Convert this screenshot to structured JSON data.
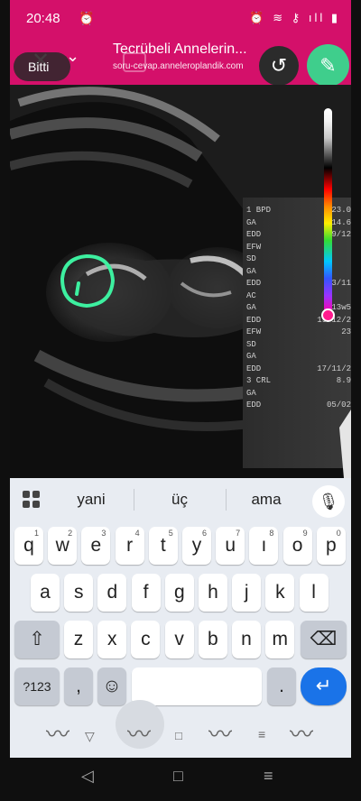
{
  "status": {
    "time": "20:48",
    "right_icons": "⏰ ≋ ⚷ ıll ▮"
  },
  "app_bar": {
    "title": "Tecrübeli Annelerin...",
    "url": "soru-cevap.anneleroplandik.com",
    "done_label": "Bitti"
  },
  "ultrasound": {
    "labels": [
      "1 BPD",
      "GA",
      "EDD",
      "EFW",
      "SD",
      "GA",
      "EDD",
      "AC",
      "GA",
      "EDD",
      "EFW",
      "SD",
      "GA",
      "EDD",
      "3 CRL",
      "GA",
      "EDD"
    ],
    "values": [
      "23.0",
      "14.6",
      "19/12",
      "",
      "",
      "",
      "13/11",
      "",
      "13w5",
      "19/12/2",
      "23",
      "",
      "",
      "17/11/2",
      "8.9",
      "",
      "05/02"
    ]
  },
  "keyboard": {
    "suggestions": [
      "yani",
      "üç",
      "ama"
    ],
    "row1": [
      {
        "k": "q",
        "h": "1"
      },
      {
        "k": "w",
        "h": "2"
      },
      {
        "k": "e",
        "h": "3"
      },
      {
        "k": "r",
        "h": "4"
      },
      {
        "k": "t",
        "h": "5"
      },
      {
        "k": "y",
        "h": "6"
      },
      {
        "k": "u",
        "h": "7"
      },
      {
        "k": "ı",
        "h": "8"
      },
      {
        "k": "o",
        "h": "9"
      },
      {
        "k": "p",
        "h": "0"
      }
    ],
    "row2": [
      "a",
      "s",
      "d",
      "f",
      "g",
      "h",
      "j",
      "k",
      "l"
    ],
    "row3": [
      "z",
      "x",
      "c",
      "v",
      "b",
      "n",
      "m"
    ],
    "symbols_label": "?123",
    "comma_label": ",",
    "period_label": ".",
    "emoji_label": "☺",
    "shift_icon": "⇧",
    "backspace_icon": "⌫",
    "enter_icon": "↵"
  },
  "colors": {
    "accent": "#d4106a",
    "pen_green": "#3fce8c",
    "annotation_green": "#3df0a0",
    "enter_blue": "#1a73e8"
  }
}
